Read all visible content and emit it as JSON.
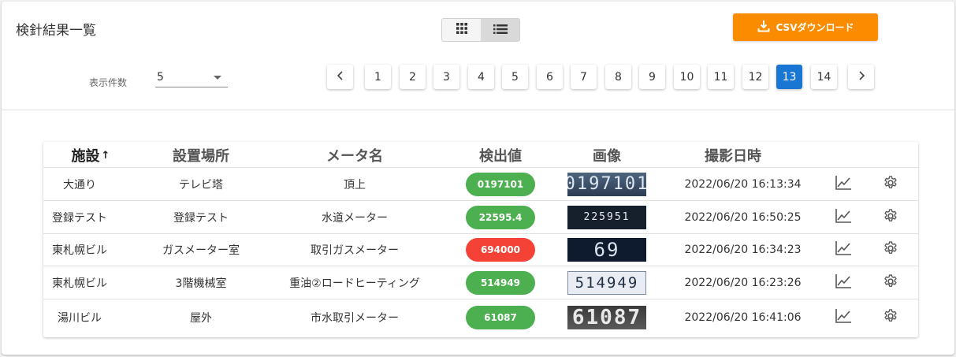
{
  "header": {
    "title": "検針結果一覧",
    "csv_button_label": "CSVダウンロード",
    "view_toggle": {
      "active": "list"
    }
  },
  "controls": {
    "rows_per_page_label": "表示件数",
    "rows_per_page_value": "5"
  },
  "pagination": {
    "pages": [
      "1",
      "2",
      "3",
      "4",
      "5",
      "6",
      "7",
      "8",
      "9",
      "10",
      "11",
      "12",
      "13",
      "14"
    ],
    "current_page": "13"
  },
  "table": {
    "columns": [
      "施設",
      "設置場所",
      "メータ名",
      "検出値",
      "画像",
      "撮影日時"
    ],
    "sort_column": "施設",
    "sort_indicator": "↑",
    "rows": [
      {
        "facility": "大通り",
        "location": "テレビ塔",
        "meter": "頂上",
        "value": "0197101",
        "status": "ok",
        "image_text": "0197101",
        "datetime": "2022/06/20 16:13:34"
      },
      {
        "facility": "登録テスト",
        "location": "登録テスト",
        "meter": "水道メーター",
        "value": "22595.4",
        "status": "ok",
        "image_text": "225951",
        "datetime": "2022/06/20 16:50:25"
      },
      {
        "facility": "東札幌ビル",
        "location": "ガスメーター室",
        "meter": "取引ガスメーター",
        "value": "694000",
        "status": "alert",
        "image_text": "69",
        "datetime": "2022/06/20 16:34:23"
      },
      {
        "facility": "東札幌ビル",
        "location": "3階機械室",
        "meter": "重油②ロードヒーティング",
        "value": "514949",
        "status": "ok",
        "image_text": "514949",
        "datetime": "2022/06/20 16:23:26"
      },
      {
        "facility": "湯川ビル",
        "location": "屋外",
        "meter": "市水取引メーター",
        "value": "61087",
        "status": "ok",
        "image_text": "61087",
        "datetime": "2022/06/20 16:41:06"
      }
    ]
  },
  "colors": {
    "accent_orange": "#fb8c00",
    "active_page_blue": "#1976d2",
    "ok_green": "#4caf50",
    "alert_red": "#f44336"
  },
  "icons": {
    "grid_view": "grid-icon",
    "list_view": "list-icon",
    "download": "download-icon",
    "prev": "chevron-left-icon",
    "next": "chevron-right-icon",
    "chart": "line-chart-icon",
    "settings": "gear-icon"
  }
}
